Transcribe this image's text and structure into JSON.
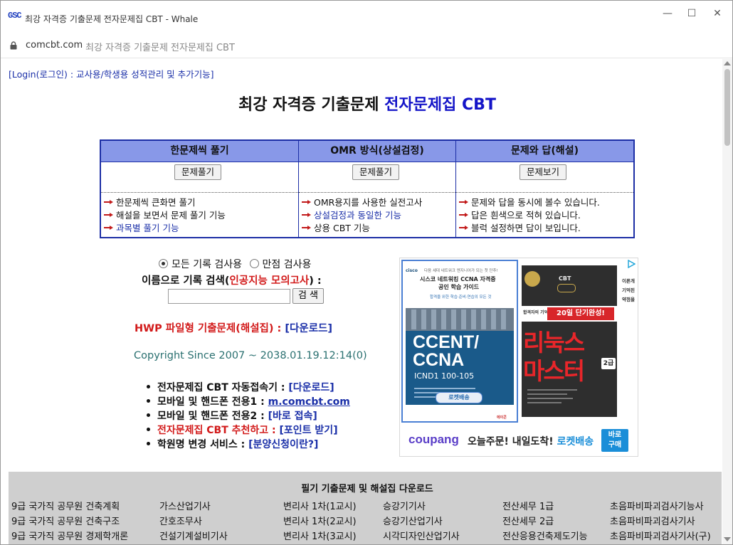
{
  "window": {
    "logo": "GSC",
    "title": "최강 자격증 기출문제 전자문제집 CBT - Whale",
    "minimize": "—",
    "maximize": "☐",
    "close": "✕"
  },
  "address": {
    "domain": "comcbt.com",
    "page_title": "최강 자격증 기출문제 전자문제집 CBT"
  },
  "header": {
    "login_link": "[Login(로그인) : 교사용/학생용 성적관리 및 추가기능]",
    "title_black": "최강 자격증 기출문제 ",
    "title_blue": "전자문제집 CBT"
  },
  "modes": [
    {
      "header": "한문제씩 풀기",
      "button": "문제풀기",
      "features": [
        "한문제씩 큰화면 풀기",
        "해설을 보면서 문제 풀기 기능",
        "과목별 풀기 기능"
      ]
    },
    {
      "header": "OMR 방식(상설검정)",
      "button": "문제풀기",
      "features": [
        "OMR용지를 사용한 실전고사",
        "상설검정과 동일한 기능",
        "상용 CBT 기능"
      ]
    },
    {
      "header": "문제와 답(해설)",
      "button": "문제보기",
      "features": [
        "문제와 답을 동시에 볼수 있습니다.",
        "답은 흰색으로 적혀 있습니다.",
        "블럭 설정하면 답이 보입니다."
      ]
    }
  ],
  "search": {
    "option_all": "모든 기록 검사용",
    "option_perfect": "만점 검사용",
    "label_prefix": "이름으로 기록 검색(",
    "label_red": "인공지능 모의고사",
    "label_suffix": ") :",
    "input_value": "",
    "button": "검 색"
  },
  "hwp": {
    "text": "HWP 파일형 기출문제(해설집) : ",
    "link": "[다운로드]"
  },
  "copyright": "Copyright Since 2007 ~ 2038.01.19.12:14(0)",
  "links": [
    {
      "label": "전자문제집 CBT 자동접속기 : ",
      "link": "[다운로드]"
    },
    {
      "label": "모바일 및 핸드폰 전용1 : ",
      "link": "m.comcbt.com"
    },
    {
      "label": "모바일 및 핸드폰 전용2 : ",
      "link": "[바로 접속]"
    },
    {
      "label": "전자문제집 CBT 추천하고 : ",
      "link": "[포인트 받기]"
    },
    {
      "label": "학원명 변경 서비스 : ",
      "link": "[분양신청이란?]"
    }
  ],
  "ad": {
    "book1": {
      "brand": "cisco",
      "tagline": "다음 세대 네트워크 엔지니어가 되는 첫 단추!",
      "title1": "시스코 네트워킹 CCNA 자격증",
      "title2": "공인 학습 가이드",
      "subtitle": "합격을 위한 학습·준비·연습의 모든 것",
      "cover1": "CCENT/",
      "cover2": "CCNA",
      "cover3": "ICND1 100-105",
      "badge": "로켓배송",
      "publisher": "에이콘"
    },
    "book2": {
      "cbt": "CBT",
      "banner_small": "합격자의 기억",
      "banner": "20일 단기완성!",
      "big1": "리눅스",
      "big2": "마스터",
      "grade": "2급",
      "side": [
        "이론개",
        "기억된",
        "약점을"
      ]
    },
    "coupang": {
      "logo": "coupang",
      "text": "오늘주문! 내일도착! ",
      "text_blue": "로켓배송",
      "button_line1": "바로",
      "button_line2": "구매"
    }
  },
  "downloads": {
    "title": "필기 기출문제 및 해설집 다운로드",
    "columns": [
      [
        "9급 국가직 공무원 건축계획",
        "9급 국가직 공무원 건축구조",
        "9급 국가직 공무원 경제학개론"
      ],
      [
        "가스산업기사",
        "간호조무사",
        "건설기계설비기사"
      ],
      [
        "변리사 1차(1교시)",
        "변리사 1차(2교시)",
        "변리사 1차(3교시)"
      ],
      [
        "승강기기사",
        "승강기산업기사",
        "시각디자인산업기사"
      ],
      [
        "전산세무 1급",
        "전산세무 2급",
        "전산응용건축제도기능"
      ],
      [
        "초음파비파괴검사기능사",
        "초음파비파괴검사기사",
        "초음파비파괴검사기사(구)"
      ]
    ]
  },
  "colors": {
    "accent_blue": "#1a2fa8",
    "title_blue": "#1414c8",
    "red": "#d21a1a",
    "table_header": "#8898e8",
    "copyright": "#2a7070",
    "download_bg": "#cfcfcf"
  }
}
